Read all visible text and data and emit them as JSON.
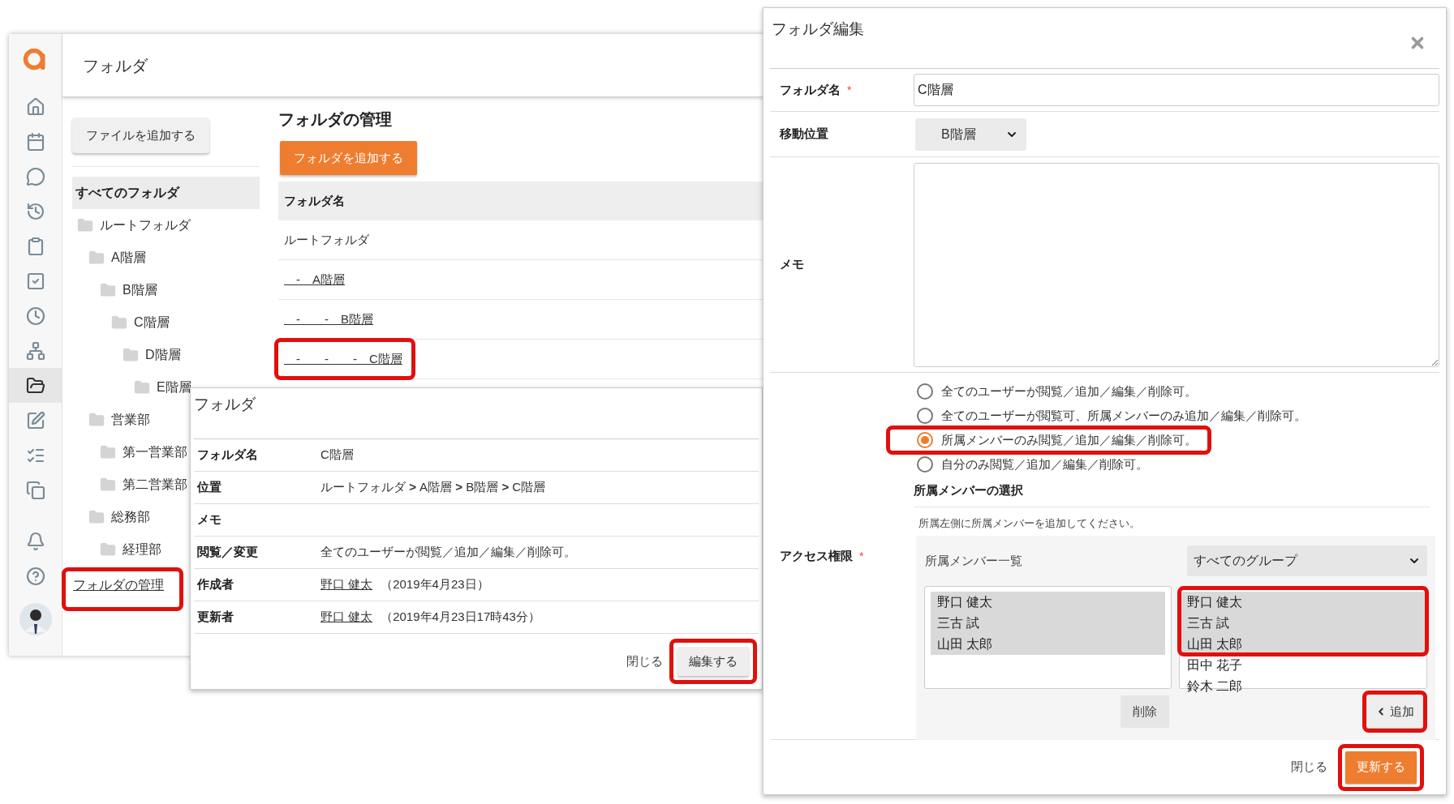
{
  "app": {
    "nav": [
      {
        "selected": false
      },
      {
        "selected": false
      },
      {
        "selected": false
      },
      {
        "selected": false
      },
      {
        "selected": false
      },
      {
        "selected": false
      },
      {
        "selected": false
      },
      {
        "selected": false
      },
      {
        "selected": true
      },
      {
        "selected": false
      },
      {
        "selected": false
      },
      {
        "selected": false
      }
    ],
    "nav_bottom": [
      {
        "selected": false
      },
      {
        "selected": false
      }
    ],
    "header": {
      "title": "フォルダ"
    },
    "add_file_button": "ファイルを追加する",
    "tree": {
      "all_folders": {
        "label": "すべてのフォルダ",
        "selected": true
      },
      "items": [
        {
          "label": "ルートフォルダ",
          "children": [
            {
              "label": "A階層",
              "children": [
                {
                  "label": "B階層",
                  "children": [
                    {
                      "label": "C階層",
                      "children": [
                        {
                          "label": "D階層",
                          "children": [
                            {
                              "label": "E階層"
                            }
                          ]
                        }
                      ]
                    }
                  ]
                }
              ]
            },
            {
              "label": "営業部",
              "children": [
                {
                  "label": "第一営業部"
                },
                {
                  "label": "第二営業部"
                }
              ]
            },
            {
              "label": "総務部",
              "children": [
                {
                  "label": "経理部"
                }
              ]
            }
          ]
        }
      ]
    },
    "manage_link": {
      "label": "フォルダの管理",
      "highlighted": true
    },
    "manage": {
      "title": "フォルダの管理",
      "add_button": "フォルダを追加する",
      "table": {
        "columns": [
          "フォルダ名"
        ],
        "rows": [
          {
            "name": "ルートフォルダ",
            "kind": "plain",
            "highlighted": false
          },
          {
            "name": "　-　A階層",
            "kind": "link",
            "highlighted": false
          },
          {
            "name": "　-　　-　B階層",
            "kind": "link",
            "highlighted": false
          },
          {
            "name": "　-　　-　　-　C階層",
            "kind": "link",
            "highlighted": true
          }
        ]
      }
    }
  },
  "detail_dialog": {
    "title": "フォルダ",
    "rows": [
      {
        "label": "フォルダ名",
        "kind": "text",
        "value": "C階層"
      },
      {
        "label": "位置",
        "kind": "text",
        "value": "ルートフォルダ **>** A階層 **>** B階層 **>** C階層"
      },
      {
        "label": "メモ",
        "kind": "text",
        "value": ""
      },
      {
        "label": "閲覧／変更",
        "kind": "text",
        "value": "全てのユーザーが閲覧／追加／編集／削除可。"
      },
      {
        "label": "作成者",
        "kind": "person",
        "name": "野口 健太",
        "date": "（2019年4月23日）"
      },
      {
        "label": "更新者",
        "kind": "person",
        "name": "野口 健太",
        "date": "（2019年4月23日17時43分）"
      }
    ],
    "close": "閉じる",
    "edit_button": {
      "label": "編集する",
      "highlighted": true
    }
  },
  "edit_dialog": {
    "title": "フォルダ編集",
    "name_field": {
      "label": "フォルダ名",
      "required_mark": "*",
      "value": "C階層"
    },
    "move_field": {
      "label": "移動位置",
      "value": "B階層"
    },
    "memo_field": {
      "label": "メモ"
    },
    "access": {
      "label": "アクセス権限",
      "required_mark": "*",
      "options": [
        {
          "label": "全てのユーザーが閲覧／追加／編集／削除可。",
          "selected": false,
          "highlighted": false
        },
        {
          "label": "全てのユーザーが閲覧可、所属メンバーのみ追加／編集／削除可。",
          "selected": false,
          "highlighted": false
        },
        {
          "label": "所属メンバーのみ閲覧／追加／編集／削除可。",
          "selected": true,
          "highlighted": true
        },
        {
          "label": "自分のみ閲覧／追加／編集／削除可。",
          "selected": false,
          "highlighted": false
        }
      ],
      "members_title": "所属メンバーの選択",
      "help": "所属左側に所属メンバーを追加してください。",
      "list_label": "所属メンバー一覧",
      "group_select": "すべてのグループ",
      "left_list": [
        {
          "name": "野口 健太",
          "selected": true
        },
        {
          "name": "三古 試",
          "selected": true
        },
        {
          "name": "山田 太郎",
          "selected": true
        }
      ],
      "right_list": {
        "highlighted": true,
        "items": [
          {
            "name": "野口 健太",
            "selected": true
          },
          {
            "name": "三古 試",
            "selected": true
          },
          {
            "name": "山田 太郎",
            "selected": true
          },
          {
            "name": "田中 花子",
            "selected": false
          },
          {
            "name": "鈴木 二郎",
            "selected": false
          }
        ]
      },
      "remove_button": "削除",
      "add_button": {
        "label": "追加",
        "highlighted": true
      }
    },
    "close": "閉じる",
    "update_button": {
      "label": "更新する",
      "highlighted": true
    }
  }
}
